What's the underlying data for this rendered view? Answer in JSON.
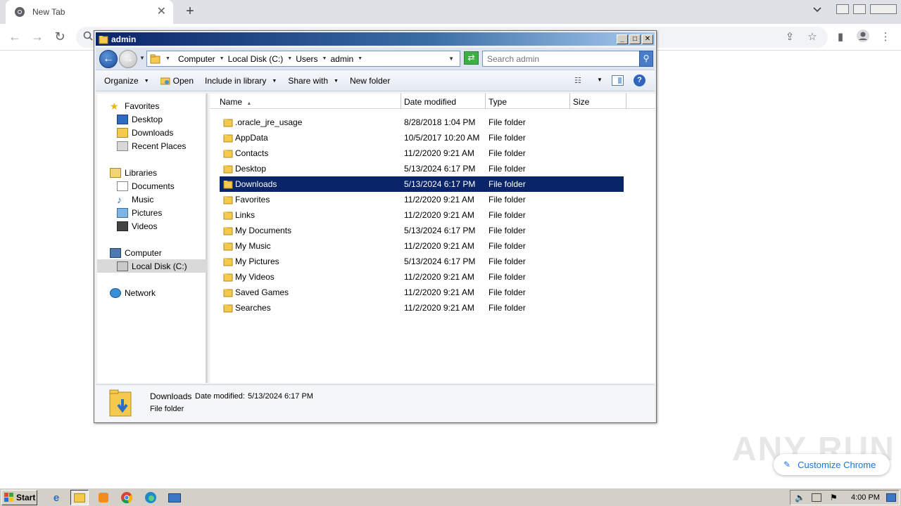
{
  "browser": {
    "tab_title": "New Tab",
    "tab_close": "✕",
    "new_tab": "+",
    "customize_label": "Customize Chrome",
    "watermark": "ANY RUN"
  },
  "explorer": {
    "title": "admin",
    "breadcrumbs": [
      "Computer",
      "Local Disk (C:)",
      "Users",
      "admin"
    ],
    "search_placeholder": "Search admin",
    "commands": {
      "organize": "Organize",
      "open": "Open",
      "include": "Include in library",
      "share": "Share with",
      "new_folder": "New folder"
    },
    "nav": {
      "favorites": "Favorites",
      "desktop": "Desktop",
      "downloads": "Downloads",
      "recent": "Recent Places",
      "libraries": "Libraries",
      "documents": "Documents",
      "music": "Music",
      "pictures": "Pictures",
      "videos": "Videos",
      "computer": "Computer",
      "localdisk": "Local Disk (C:)",
      "network": "Network"
    },
    "columns": {
      "name": "Name",
      "date": "Date modified",
      "type": "Type",
      "size": "Size"
    },
    "files": [
      {
        "name": ".oracle_jre_usage",
        "date": "8/28/2018 1:04 PM",
        "type": "File folder"
      },
      {
        "name": "AppData",
        "date": "10/5/2017 10:20 AM",
        "type": "File folder"
      },
      {
        "name": "Contacts",
        "date": "11/2/2020 9:21 AM",
        "type": "File folder"
      },
      {
        "name": "Desktop",
        "date": "5/13/2024 6:17 PM",
        "type": "File folder"
      },
      {
        "name": "Downloads",
        "date": "5/13/2024 6:17 PM",
        "type": "File folder"
      },
      {
        "name": "Favorites",
        "date": "11/2/2020 9:21 AM",
        "type": "File folder"
      },
      {
        "name": "Links",
        "date": "11/2/2020 9:21 AM",
        "type": "File folder"
      },
      {
        "name": "My Documents",
        "date": "5/13/2024 6:17 PM",
        "type": "File folder"
      },
      {
        "name": "My Music",
        "date": "11/2/2020 9:21 AM",
        "type": "File folder"
      },
      {
        "name": "My Pictures",
        "date": "5/13/2024 6:17 PM",
        "type": "File folder"
      },
      {
        "name": "My Videos",
        "date": "11/2/2020 9:21 AM",
        "type": "File folder"
      },
      {
        "name": "Saved Games",
        "date": "11/2/2020 9:21 AM",
        "type": "File folder"
      },
      {
        "name": "Searches",
        "date": "11/2/2020 9:21 AM",
        "type": "File folder"
      }
    ],
    "details": {
      "name": "Downloads",
      "modified_label": "Date modified:",
      "modified_value": "5/13/2024 6:17 PM",
      "type": "File folder"
    }
  },
  "taskbar": {
    "start": "Start",
    "clock": "4:00 PM"
  },
  "colors": {
    "selection": "#0a246a",
    "title_gradient_start": "#0a246a",
    "accent_link": "#1a73e8"
  }
}
